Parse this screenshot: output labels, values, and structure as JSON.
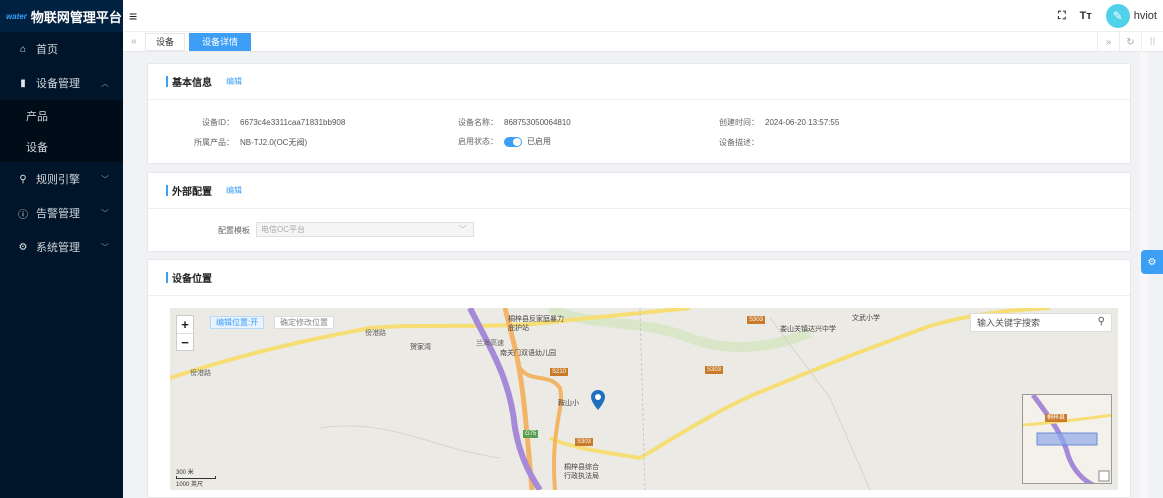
{
  "app": {
    "logo_mark": "water",
    "title": "物联网管理平台"
  },
  "sidebar": {
    "items": [
      {
        "icon": "home-icon",
        "glyph": "⌂",
        "label": "首页"
      },
      {
        "icon": "device-icon",
        "glyph": "▮",
        "label": "设备管理",
        "expanded": true,
        "children": [
          {
            "label": "产品"
          },
          {
            "label": "设备"
          }
        ]
      },
      {
        "icon": "rule-engine-icon",
        "glyph": "⚲",
        "label": "规则引擎"
      },
      {
        "icon": "alarm-icon",
        "glyph": "ⓘ",
        "label": "告警管理"
      },
      {
        "icon": "settings-icon",
        "glyph": "⚙",
        "label": "系统管理"
      }
    ]
  },
  "topbar": {
    "username": "hviot",
    "fullscreen_icon": "fullscreen-icon",
    "font_icon_label": "Tт"
  },
  "tabs": {
    "items": [
      {
        "label": "设备",
        "active": false
      },
      {
        "label": "设备详情",
        "active": true
      }
    ]
  },
  "basic": {
    "title": "基本信息",
    "edit": "编辑",
    "device_id_label": "设备ID：",
    "device_id": "6673c4e3311caa71831bb908",
    "device_name_label": "设备名称：",
    "device_name": "868753050064810",
    "created_label": "创建时间：",
    "created": "2024-06-20 13:57:55",
    "product_label": "所属产品：",
    "product": "NB-TJ2.0(OC无阀)",
    "status_label": "启用状态：",
    "status": "已启用",
    "desc_label": "设备描述：",
    "desc": ""
  },
  "external": {
    "title": "外部配置",
    "edit": "编辑",
    "template_label": "配置模板",
    "template_value": "电信OC平台"
  },
  "location": {
    "title": "设备位置",
    "edit_btn": "编辑位置:开",
    "confirm_btn": "确定修改位置",
    "search_placeholder": "输入关键字搜索",
    "labels": {
      "l1": "桐梓县反家庭暴力",
      "l2": "庇护站",
      "l3": "南关门双语幼儿园",
      "l4": "鞍山小",
      "l5": "桐梓县综合",
      "l6": "行政执法局",
      "l7": "娄山关镇达兴中学",
      "l8": "文武小学",
      "l9": "贺家湾",
      "r1": "傍港路",
      "r2": "傍港路",
      "r3": "兰海高速",
      "s1": "S210",
      "s2": "S303",
      "s3": "S303",
      "s4": "S303",
      "s5": "G75",
      "ov": "桐梓县",
      "scale1": "300 米",
      "scale2": "1000 英尺"
    }
  }
}
